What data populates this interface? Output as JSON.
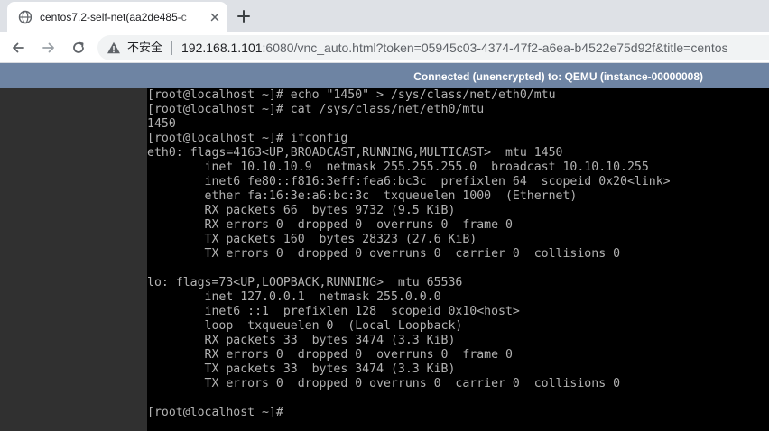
{
  "tab": {
    "title": "centos7.2-self-net(aa2de485-c",
    "favicon": "globe-icon"
  },
  "toolbar": {
    "security_label": "不安全",
    "url_host": "192.168.1.101",
    "url_rest": ":6080/vnc_auto.html?token=05945c03-4374-47f2-a6ea-b4522e75d92f&title=centos"
  },
  "vnc": {
    "status": "Connected (unencrypted) to: QEMU (instance-00000008)",
    "status_bg": "#6e84a3"
  },
  "terminal": {
    "fg": "#b2b2b2",
    "bg": "#000000",
    "lines": [
      "[root@localhost ~]# echo \"1450\" > /sys/class/net/eth0/mtu",
      "[root@localhost ~]# cat /sys/class/net/eth0/mtu",
      "1450",
      "[root@localhost ~]# ifconfig",
      "eth0: flags=4163<UP,BROADCAST,RUNNING,MULTICAST>  mtu 1450",
      "        inet 10.10.10.9  netmask 255.255.255.0  broadcast 10.10.10.255",
      "        inet6 fe80::f816:3eff:fea6:bc3c  prefixlen 64  scopeid 0x20<link>",
      "        ether fa:16:3e:a6:bc:3c  txqueuelen 1000  (Ethernet)",
      "        RX packets 66  bytes 9732 (9.5 KiB)",
      "        RX errors 0  dropped 0  overruns 0  frame 0",
      "        TX packets 160  bytes 28323 (27.6 KiB)",
      "        TX errors 0  dropped 0 overruns 0  carrier 0  collisions 0",
      "",
      "lo: flags=73<UP,LOOPBACK,RUNNING>  mtu 65536",
      "        inet 127.0.0.1  netmask 255.0.0.0",
      "        inet6 ::1  prefixlen 128  scopeid 0x10<host>",
      "        loop  txqueuelen 0  (Local Loopback)",
      "        RX packets 33  bytes 3474 (3.3 KiB)",
      "        RX errors 0  dropped 0  overruns 0  frame 0",
      "        TX packets 33  bytes 3474 (3.3 KiB)",
      "        TX errors 0  dropped 0 overruns 0  carrier 0  collisions 0",
      "",
      "[root@localhost ~]#"
    ]
  }
}
